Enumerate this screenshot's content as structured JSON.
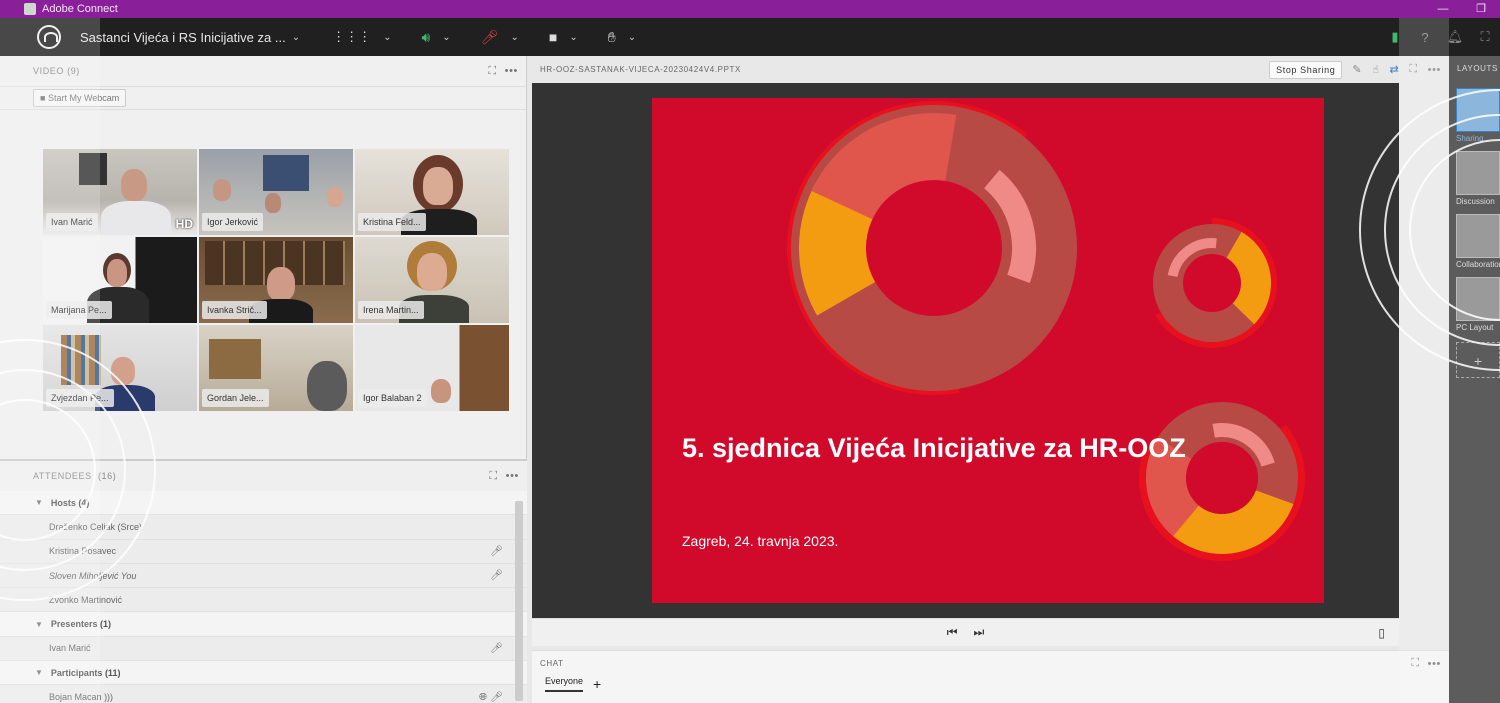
{
  "window": {
    "app_title": "Adobe Connect"
  },
  "toolbar": {
    "meeting_title": "Sastanci Vijeća i RS Inicijative za ..."
  },
  "video_pod": {
    "header": "VIDEO (9)",
    "webcam_button": "Start My Webcam",
    "tiles": [
      {
        "name": "Ivan Marić",
        "hd": "HD"
      },
      {
        "name": "Igor Jerković"
      },
      {
        "name": "Kristina Feld..."
      },
      {
        "name": "Marijana Pe..."
      },
      {
        "name": "Ivanka Strič..."
      },
      {
        "name": "Irena Martin..."
      },
      {
        "name": "Zvjezdan Pe..."
      },
      {
        "name": "Gordan Jele..."
      },
      {
        "name": "Igor Balaban 2"
      }
    ]
  },
  "attendees_pod": {
    "header": "ATTENDEES",
    "count": "(16)",
    "rows": [
      {
        "type": "group",
        "label": "Hosts (4)"
      },
      {
        "type": "person",
        "label": "Draženko Celjak (Srce)"
      },
      {
        "type": "person",
        "label": "Kristina Posavec"
      },
      {
        "type": "person",
        "label": "Sloven Miholjević You"
      },
      {
        "type": "person",
        "label": "Zvonko Martinović"
      },
      {
        "type": "group",
        "label": "Presenters (1)"
      },
      {
        "type": "person",
        "label": "Ivan Marić"
      },
      {
        "type": "group",
        "label": "Participants (11)"
      },
      {
        "type": "person",
        "label": "Bojan Macan"
      }
    ]
  },
  "share_pod": {
    "filename": "HR-OOZ-SASTANAK-VIJECA-20230424V4.PPTX",
    "stop_sharing": "Stop Sharing",
    "slide": {
      "title": "5. sjednica Vijeća Inicijative za HR-OOZ",
      "subtitle": "Zagreb, 24. travnja 2023.",
      "background": "#d10a2c"
    }
  },
  "chat_pod": {
    "header": "CHAT",
    "tab_everyone": "Everyone",
    "add_tab": "+"
  },
  "layouts": {
    "header": "LAYOUTS",
    "items": [
      {
        "label": "Sharing",
        "active": true
      },
      {
        "label": "Discussion",
        "active": false
      },
      {
        "label": "Collaboration",
        "active": false
      },
      {
        "label": "PC Layout",
        "active": false
      }
    ]
  },
  "colors": {
    "titlebar": "#8a1f9a",
    "toolbar": "#202020",
    "accent": "#3b82c4",
    "slide_red": "#d10a2c",
    "orange": "#f39c12"
  }
}
